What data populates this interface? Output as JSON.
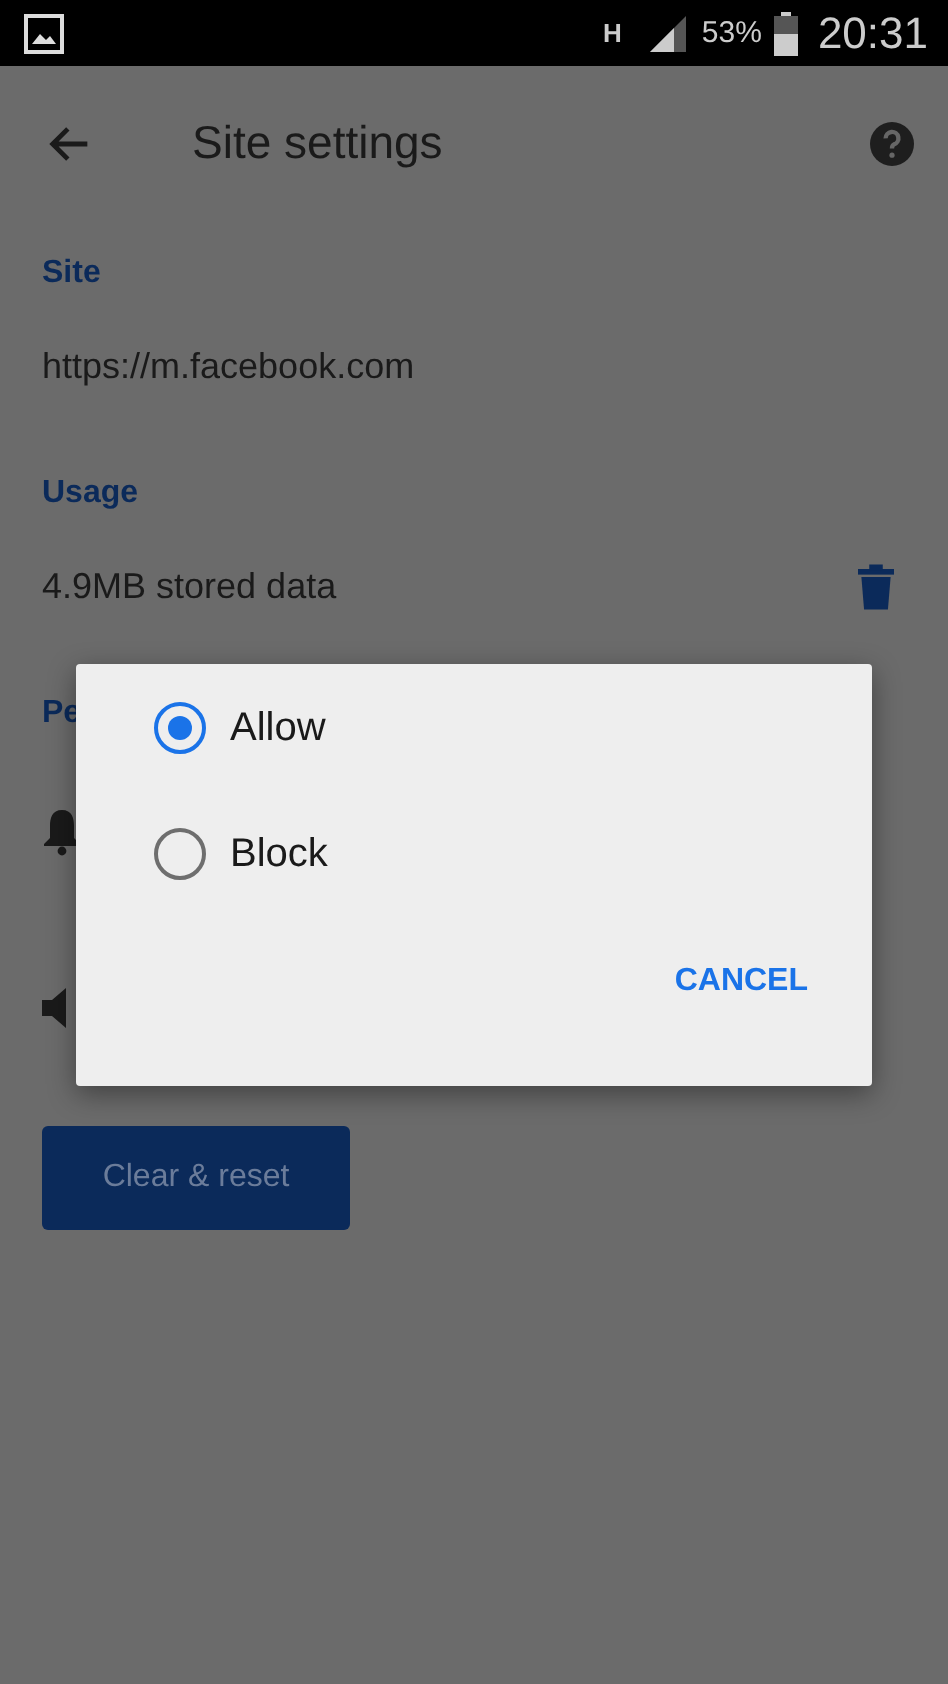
{
  "status_bar": {
    "network": "H",
    "battery": "53%",
    "time": "20:31"
  },
  "toolbar": {
    "title": "Site settings"
  },
  "sections": [
    {
      "heading": "Site",
      "value": "https://m.facebook.com"
    },
    {
      "heading": "Usage",
      "value": "4.9MB stored data"
    }
  ],
  "permissions_heading": "Pe",
  "reset_button": "Clear & reset",
  "dialog": {
    "options": [
      {
        "label": "Allow",
        "selected": true
      },
      {
        "label": "Block",
        "selected": false
      }
    ],
    "cancel": "CANCEL"
  }
}
